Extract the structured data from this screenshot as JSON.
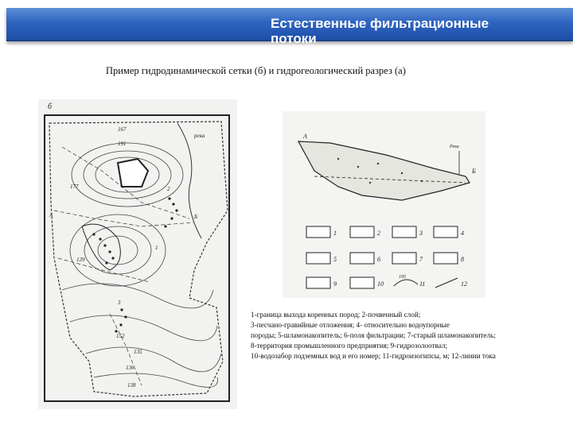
{
  "header": {
    "title": "Естественные фильтрационные потоки"
  },
  "caption": "Пример гидродинамической сетки (б) и гидрогеологический разрез (а)",
  "map": {
    "corner_label": "б",
    "labels": [
      "А",
      "Б",
      "река",
      "1",
      "2",
      "3"
    ],
    "contour_values": [
      "167",
      "191",
      "177",
      "139",
      "152",
      "135",
      "136",
      "138"
    ]
  },
  "section": {
    "labels": [
      "А",
      "Б",
      "Река"
    ],
    "legend_numbers": [
      "1",
      "2",
      "3",
      "4",
      "5",
      "6",
      "7",
      "8",
      "9",
      "10",
      "11",
      "12"
    ],
    "legend_contour_value": "195"
  },
  "legend_lines": [
    "1-граница выхода коренных пород; 2-почвенный слой;",
    "3-песчано-гравийные отложения; 4- относительно водоупорные",
    "породы; 5-шламонакопитель; 6-поля фильтрации; 7-старый шламонакопитель;",
    "8-территория промышленного предприятия; 9-гидрозолоотвал;",
    "10-водозабор подземных вод и его номер; 11-гидроизогипсы, м; 12-линии тока"
  ]
}
